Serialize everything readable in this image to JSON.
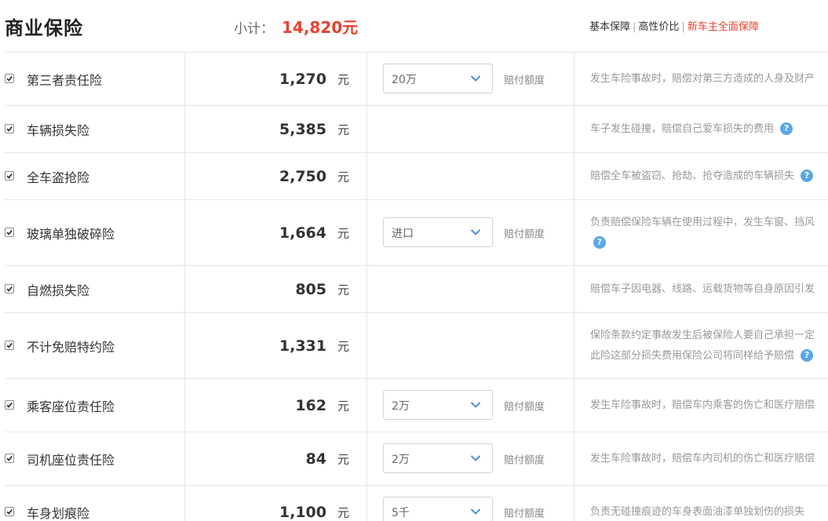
{
  "header": {
    "title": "商业保险",
    "subtotal_label": "小计：",
    "subtotal_value": "14,820元",
    "plans": [
      "基本保障",
      "高性价比",
      "新车主全面保障"
    ]
  },
  "unit": "元",
  "limit_label": "赔付额度",
  "colors": {
    "accent": "#e8412f",
    "help": "#5aa7e8"
  },
  "rows": [
    {
      "name": "第三者责任险",
      "price": "1,270",
      "select": "20万",
      "desc1": "发生车险事故时，赔偿对第三方造成的人身及财产",
      "desc2": ""
    },
    {
      "name": "车辆损失险",
      "price": "5,385",
      "select": "",
      "desc1": "车子发生碰撞，赔偿自己爱车损失的费用",
      "desc2": ""
    },
    {
      "name": "全车盗抢险",
      "price": "2,750",
      "select": "",
      "desc1": "赔偿全车被盗窃、抢劫、抢夺造成的车辆损失",
      "desc2": ""
    },
    {
      "name": "玻璃单独破碎险",
      "price": "1,664",
      "select": "进口",
      "desc1": "负责赔偿保险车辆在使用过程中，发生车窗、挡风",
      "desc2": ""
    },
    {
      "name": "自燃损失险",
      "price": "805",
      "select": "",
      "desc1": "赔偿车子因电器、线路、运载货物等自身原因引发",
      "desc2": ""
    },
    {
      "name": "不计免赔特约险",
      "price": "1,331",
      "select": "",
      "desc1": "保险条款约定事故发生后被保险人要自己承担一定",
      "desc2": "此险这部分损失费用保险公司将同样给予赔偿"
    },
    {
      "name": "乘客座位责任险",
      "price": "162",
      "select": "2万",
      "desc1": "发生车险事故时，赔偿车内乘客的伤亡和医疗赔偿",
      "desc2": ""
    },
    {
      "name": "司机座位责任险",
      "price": "84",
      "select": "2万",
      "desc1": "发生车险事故时，赔偿车内司机的伤亡和医疗赔偿",
      "desc2": ""
    },
    {
      "name": "车身划痕险",
      "price": "1,100",
      "select": "5千",
      "desc1": "负责无碰撞痕迹的车身表面油漆单独划伤的损失",
      "desc2": ""
    }
  ]
}
